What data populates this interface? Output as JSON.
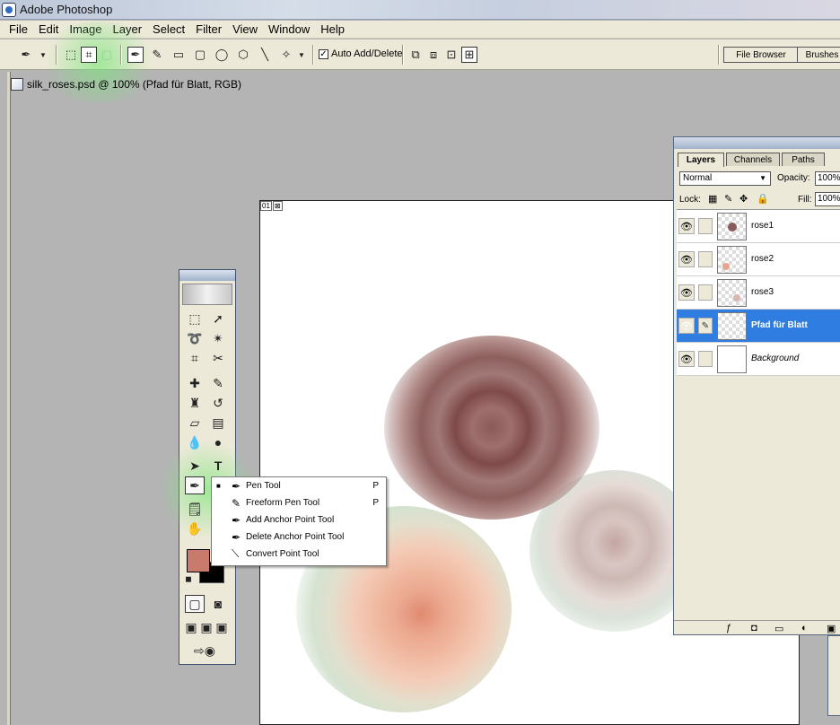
{
  "app": {
    "title": "Adobe Photoshop"
  },
  "menu": [
    "File",
    "Edit",
    "Image",
    "Layer",
    "Select",
    "Filter",
    "View",
    "Window",
    "Help"
  ],
  "options": {
    "auto_add_delete_label": "Auto Add/Delete",
    "auto_add_delete_checked": "✓",
    "file_browser_label": "File Browser",
    "brushes_label": "Brushes"
  },
  "document": {
    "title": "silk_roses.psd @ 100% (Pfad für Blatt, RGB)",
    "zoom_badge": "01"
  },
  "toolbox": {
    "type_tool_glyph": "T"
  },
  "flyout": {
    "items": [
      {
        "label": "Pen Tool",
        "shortcut": "P",
        "selected": true
      },
      {
        "label": "Freeform Pen Tool",
        "shortcut": "P",
        "selected": false
      },
      {
        "label": "Add Anchor Point Tool",
        "shortcut": "",
        "selected": false
      },
      {
        "label": "Delete Anchor Point Tool",
        "shortcut": "",
        "selected": false
      },
      {
        "label": "Convert Point Tool",
        "shortcut": "",
        "selected": false
      }
    ],
    "bullet": "■"
  },
  "layers_panel": {
    "tabs": [
      "Layers",
      "Channels",
      "Paths"
    ],
    "active_tab": "Layers",
    "blend_mode": "Normal",
    "opacity_label": "Opacity:",
    "opacity_value": "100%",
    "lock_label": "Lock:",
    "fill_label": "Fill:",
    "fill_value": "100%",
    "layers": [
      {
        "name": "rose1",
        "visible": true,
        "selected": false
      },
      {
        "name": "rose2",
        "visible": true,
        "selected": false
      },
      {
        "name": "rose3",
        "visible": true,
        "selected": false
      },
      {
        "name": "Pfad für Blatt",
        "visible": true,
        "selected": true
      },
      {
        "name": "Background",
        "visible": true,
        "selected": false
      }
    ]
  },
  "colors": {
    "foreground": "#c87a6c",
    "background": "#000000",
    "selection": "#2f7de1",
    "tool_glow": "#78e678"
  }
}
